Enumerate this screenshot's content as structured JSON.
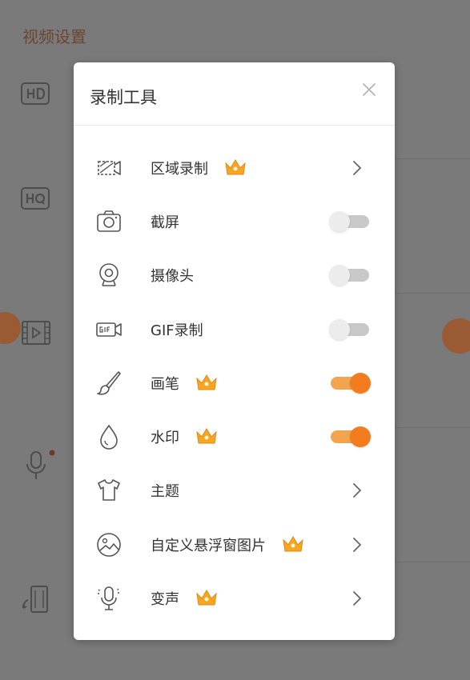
{
  "background": {
    "title": "视频设置"
  },
  "dialog": {
    "title": "录制工具",
    "items": [
      {
        "label": "区域录制",
        "icon": "area-record-icon",
        "crown": true,
        "control": "chevron"
      },
      {
        "label": "截屏",
        "icon": "camera-icon",
        "crown": false,
        "control": "toggle",
        "on": false
      },
      {
        "label": "摄像头",
        "icon": "webcam-icon",
        "crown": false,
        "control": "toggle",
        "on": false
      },
      {
        "label": "GIF录制",
        "icon": "gif-record-icon",
        "crown": false,
        "control": "toggle",
        "on": false
      },
      {
        "label": "画笔",
        "icon": "brush-icon",
        "crown": true,
        "control": "toggle",
        "on": true
      },
      {
        "label": "水印",
        "icon": "water-drop-icon",
        "crown": true,
        "control": "toggle",
        "on": true
      },
      {
        "label": "主题",
        "icon": "tshirt-icon",
        "crown": false,
        "control": "chevron"
      },
      {
        "label": "自定义悬浮窗图片",
        "icon": "image-icon",
        "crown": true,
        "control": "chevron"
      },
      {
        "label": "变声",
        "icon": "voice-changer-icon",
        "crown": true,
        "control": "chevron"
      }
    ]
  },
  "colors": {
    "accent": "#f27c1e",
    "accent_track": "#f3a44f",
    "crown": "#f6a623"
  }
}
